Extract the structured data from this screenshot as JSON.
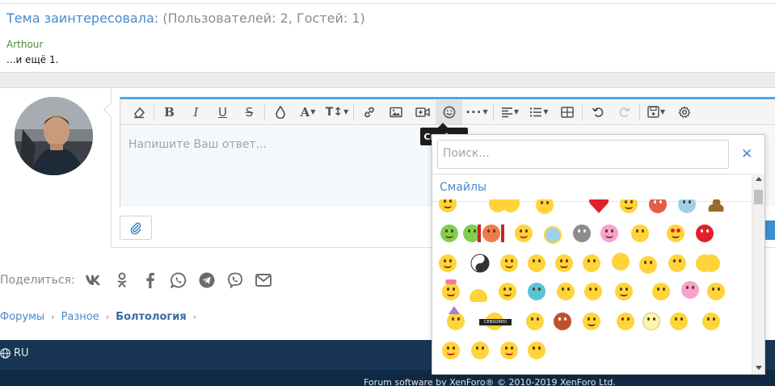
{
  "thread": {
    "interested_link": "Тема заинтересовала:",
    "interested_counts": " (Пользователей: 2, Гостей: 1)",
    "user": "Arthour",
    "user_text": "...и ещё 1."
  },
  "editor": {
    "placeholder": "Напишите Ваш ответ...",
    "toolbar": [
      "remove-format",
      "bold",
      "italic",
      "underline",
      "strikethrough",
      "color",
      "font-family",
      "font-size",
      "link",
      "image",
      "media",
      "smilies",
      "more",
      "align",
      "list",
      "table",
      "undo",
      "redo",
      "drafts",
      "options"
    ],
    "active_tool": "smilies"
  },
  "tooltip": {
    "label": "Смайлы"
  },
  "smilie_popup": {
    "search_placeholder": "Поиск...",
    "close": "✕",
    "category_title": "Смайлы",
    "censored_label": "CENSORED"
  },
  "share": {
    "label": "Поделиться:",
    "networks": [
      "vk-icon",
      "odnoklassniki-icon",
      "facebook-icon",
      "whatsapp-icon",
      "telegram-icon",
      "viber-icon",
      "email-icon"
    ]
  },
  "breadcrumbs": {
    "items": [
      "Форумы",
      "Разное",
      "Болтология"
    ],
    "separator": "›"
  },
  "footer": {
    "language": "RU",
    "copyright": "Forum software by XenForo® © 2010-2019 XenForo Ltd."
  },
  "colors": {
    "accent": "#47a7eb",
    "link": "#4a8ac8",
    "footer": "#183654",
    "smilie_yellow": "#ffd43a"
  }
}
